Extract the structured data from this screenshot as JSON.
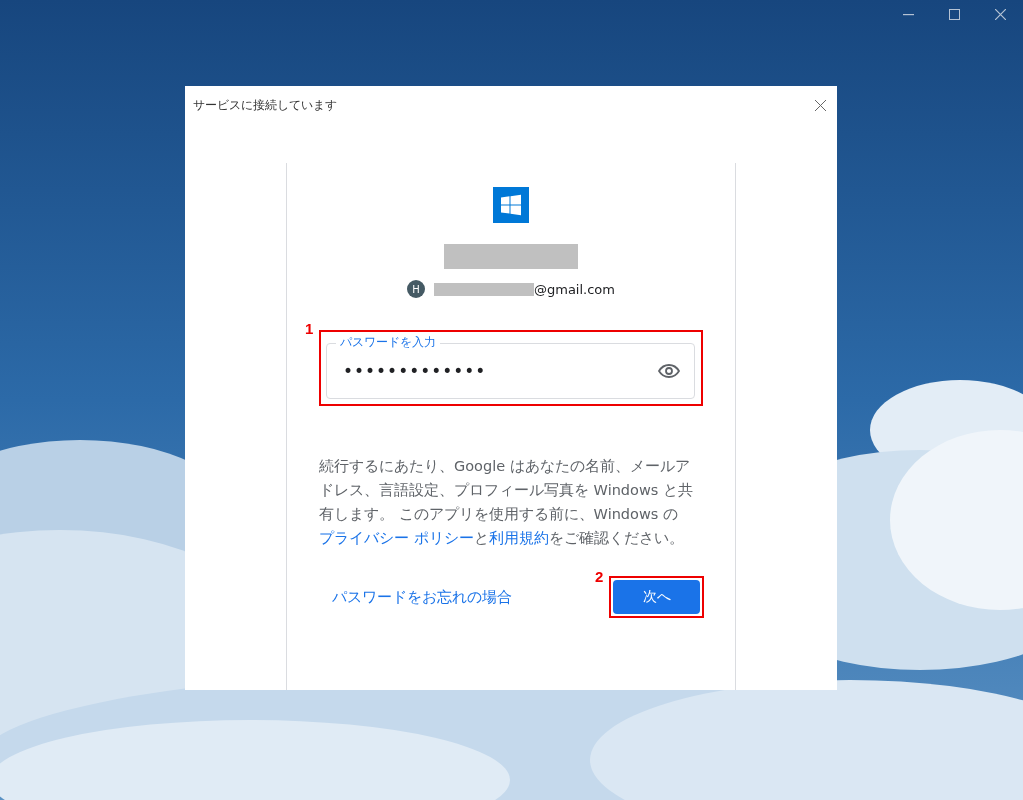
{
  "window": {
    "title": "サービスに接続しています"
  },
  "account": {
    "avatar": "H",
    "email_domain": "@gmail.com"
  },
  "password_field": {
    "label": "パスワードを入力",
    "value": "•••••••••••••"
  },
  "consent": [
    {
      "text": "続行するにあたり、Google はあなたの名前、メールアドレス、言語設定、プロフィール写真を Windows と共有します。 このアプリを使用する前に、Windows の",
      "link": false
    },
    {
      "text": "プライバシー ポリシー",
      "link": true
    },
    {
      "text": "と",
      "link": false
    },
    {
      "text": "利用規約",
      "link": true
    },
    {
      "text": "をご確認ください。",
      "link": false
    }
  ],
  "forgot_link": "パスワードをお忘れの場合",
  "next_button": "次へ",
  "annotations": [
    "1",
    "2"
  ]
}
